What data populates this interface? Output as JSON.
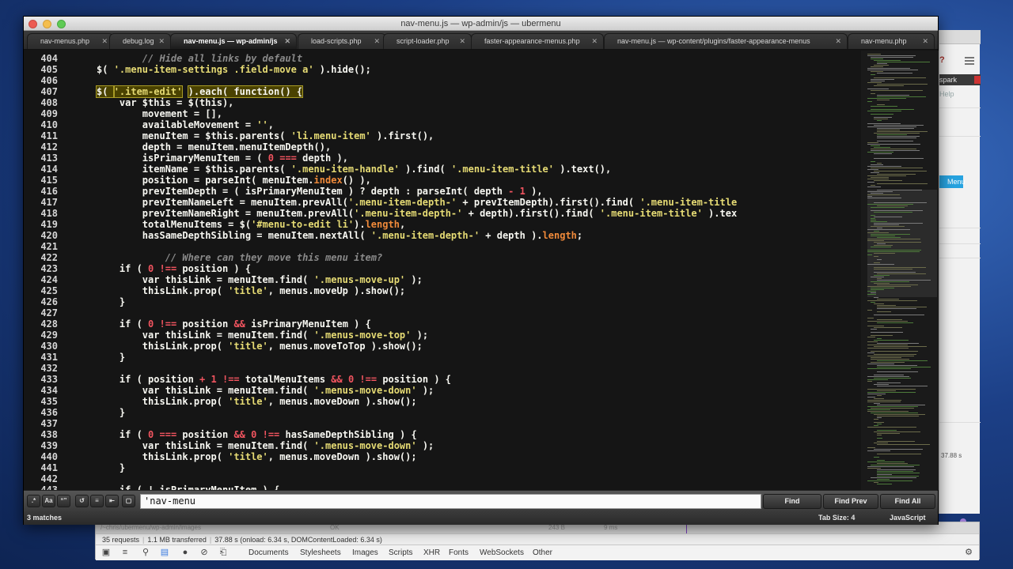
{
  "window": {
    "title": "nav-menu.js — wp-admin/js — ubermenu"
  },
  "tabs": [
    {
      "label": "nav-menus.php",
      "active": false
    },
    {
      "label": "debug.log",
      "active": false
    },
    {
      "label": "nav-menu.js — wp-admin/js",
      "active": true
    },
    {
      "label": "load-scripts.php",
      "active": false
    },
    {
      "label": "script-loader.php",
      "active": false
    },
    {
      "label": "faster-appearance-menus.php",
      "active": false
    },
    {
      "label": "nav-menu.js — wp-content/plugins/faster-appearance-menus",
      "active": false
    },
    {
      "label": "nav-menu.php",
      "active": false
    }
  ],
  "code": {
    "lines": [
      {
        "n": "404",
        "html": "<span class='t-cmt'>        // Hide all links by default</span>"
      },
      {
        "n": "405",
        "html": "        $( <span class='t-str'>'.menu-item-settings .field-move a'</span> ).hide();"
      },
      {
        "n": "406",
        "html": ""
      },
      {
        "n": "407",
        "html": "        <span class='t-hl'>$( </span><span class='t-str t-hl'>'.item-edit'</span> <span class='t-hl'>).each( function() {</span>"
      },
      {
        "n": "408",
        "html": "            var $this = $(this),"
      },
      {
        "n": "409",
        "html": "                movement = [],"
      },
      {
        "n": "410",
        "html": "                availableMovement = <span class='t-str'>''</span>,"
      },
      {
        "n": "411",
        "html": "                menuItem = $this.parents( <span class='t-str'>'li.menu-item'</span> ).first(),"
      },
      {
        "n": "412",
        "html": "                depth = menuItem.menuItemDepth(),"
      },
      {
        "n": "413",
        "html": "                isPrimaryMenuItem = ( <span class='t-num'>0</span> <span class='t-num'>===</span> depth ),"
      },
      {
        "n": "414",
        "html": "                itemName = $this.parents( <span class='t-str'>'.menu-item-handle'</span> ).find( <span class='t-str'>'.menu-item-title'</span> ).text(),"
      },
      {
        "n": "415",
        "html": "                position = parseInt( menuItem.<span class='t-prop'>index</span>() ),"
      },
      {
        "n": "416",
        "html": "                prevItemDepth = ( isPrimaryMenuItem ) ? depth : parseInt( depth <span class='t-num'>-</span> <span class='t-num'>1</span> ),"
      },
      {
        "n": "417",
        "html": "                prevItemNameLeft = menuItem.prevAll(<span class='t-str'>'.menu-item-depth-'</span> + prevItemDepth).first().find( <span class='t-str'>'.menu-item-title</span>"
      },
      {
        "n": "418",
        "html": "                prevItemNameRight = menuItem.prevAll(<span class='t-str'>'.menu-item-depth-'</span> + depth).first().find( <span class='t-str'>'.menu-item-title'</span> ).tex"
      },
      {
        "n": "419",
        "html": "                totalMenuItems = $(<span class='t-str'>'#menu-to-edit li'</span>).<span class='t-prop'>length</span>,"
      },
      {
        "n": "420",
        "html": "                hasSameDepthSibling = menuItem.nextAll( <span class='t-str'>'.menu-item-depth-'</span> + depth ).<span class='t-prop'>length</span>;"
      },
      {
        "n": "421",
        "html": ""
      },
      {
        "n": "422",
        "html": "<span class='t-cmt'>            // Where can they move this menu item?</span>"
      },
      {
        "n": "423",
        "html": "            if ( <span class='t-num'>0</span> <span class='t-num'>!==</span> position ) {"
      },
      {
        "n": "424",
        "html": "                var thisLink = menuItem.find( <span class='t-str'>'.menus-move-up'</span> );"
      },
      {
        "n": "425",
        "html": "                thisLink.prop( <span class='t-str'>'title'</span>, menus.moveUp ).show();"
      },
      {
        "n": "426",
        "html": "            }"
      },
      {
        "n": "427",
        "html": ""
      },
      {
        "n": "428",
        "html": "            if ( <span class='t-num'>0</span> <span class='t-num'>!==</span> position <span class='t-num'>&amp;&amp;</span> isPrimaryMenuItem ) {"
      },
      {
        "n": "429",
        "html": "                var thisLink = menuItem.find( <span class='t-str'>'.menus-move-top'</span> );"
      },
      {
        "n": "430",
        "html": "                thisLink.prop( <span class='t-str'>'title'</span>, menus.moveToTop ).show();"
      },
      {
        "n": "431",
        "html": "            }"
      },
      {
        "n": "432",
        "html": ""
      },
      {
        "n": "433",
        "html": "            if ( position <span class='t-num'>+</span> <span class='t-num'>1</span> <span class='t-num'>!==</span> totalMenuItems <span class='t-num'>&amp;&amp;</span> <span class='t-num'>0</span> <span class='t-num'>!==</span> position ) {"
      },
      {
        "n": "434",
        "html": "                var thisLink = menuItem.find( <span class='t-str'>'.menus-move-down'</span> );"
      },
      {
        "n": "435",
        "html": "                thisLink.prop( <span class='t-str'>'title'</span>, menus.moveDown ).show();"
      },
      {
        "n": "436",
        "html": "            }"
      },
      {
        "n": "437",
        "html": ""
      },
      {
        "n": "438",
        "html": "            if ( <span class='t-num'>0</span> <span class='t-num'>===</span> position <span class='t-num'>&amp;&amp;</span> <span class='t-num'>0</span> <span class='t-num'>!==</span> hasSameDepthSibling ) {"
      },
      {
        "n": "439",
        "html": "                var thisLink = menuItem.find( <span class='t-str'>'.menus-move-down'</span> );"
      },
      {
        "n": "440",
        "html": "                thisLink.prop( <span class='t-str'>'title'</span>, menus.moveDown ).show();"
      },
      {
        "n": "441",
        "html": "            }"
      },
      {
        "n": "442",
        "html": ""
      },
      {
        "n": "443",
        "html": "            if ( ! isPrimaryMenuItem ) {"
      }
    ]
  },
  "findbar": {
    "option_regex": ".*",
    "option_case": "Aa",
    "option_word": "“”",
    "query": "'nav-menu",
    "find_label": "Find",
    "find_prev_label": "Find Prev",
    "find_all_label": "Find All"
  },
  "statusbar": {
    "matches": "3 matches",
    "tab_size": "Tab Size: 4",
    "syntax": "JavaScript"
  },
  "background_browser": {
    "spark_label": "spark",
    "help_label": "Help",
    "menu_button": "Menu",
    "time": "37.88 s"
  },
  "devtools": {
    "row_path": "/~chris/ubermenu/wp-admin/images",
    "row_status": "OK",
    "row_size": "243 B",
    "row_time": "9 ms",
    "summary_requests": "35 requests",
    "summary_transferred": "1.1 MB transferred",
    "summary_timing": "37.88 s (onload: 6.34 s, DOMContentLoaded: 6.34 s)",
    "filters": [
      "Documents",
      "Stylesheets",
      "Images",
      "Scripts",
      "XHR",
      "Fonts",
      "WebSockets",
      "Other"
    ]
  },
  "colors": {
    "editor_bg": "#151515",
    "string": "#e6db74",
    "comment": "#8a8a8a",
    "operator": "#f0545f",
    "property": "#f08a3a",
    "highlight": "#4a4200"
  }
}
